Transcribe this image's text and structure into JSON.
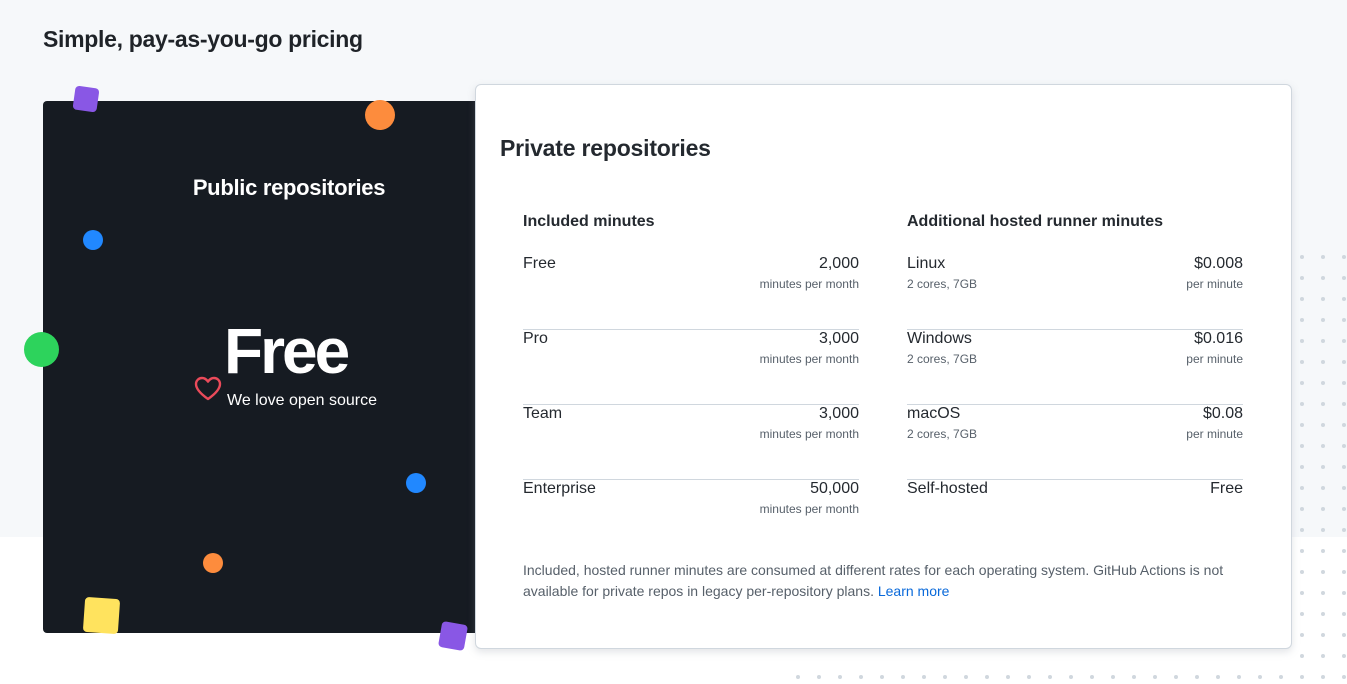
{
  "page": {
    "title": "Simple, pay-as-you-go pricing"
  },
  "public": {
    "title": "Public repositories",
    "price": "Free",
    "tagline": "We love open source"
  },
  "private": {
    "title": "Private repositories",
    "included": {
      "heading": "Included minutes",
      "rows": [
        {
          "name": "Free",
          "value": "2,000",
          "unit": "minutes per month"
        },
        {
          "name": "Pro",
          "value": "3,000",
          "unit": "minutes per month"
        },
        {
          "name": "Team",
          "value": "3,000",
          "unit": "minutes per month"
        },
        {
          "name": "Enterprise",
          "value": "50,000",
          "unit": "minutes per month"
        }
      ]
    },
    "additional": {
      "heading": "Additional hosted runner minutes",
      "rows": [
        {
          "name": "Linux",
          "spec": "2 cores, 7GB",
          "value": "$0.008",
          "unit": "per minute"
        },
        {
          "name": "Windows",
          "spec": "2 cores, 7GB",
          "value": "$0.016",
          "unit": "per minute"
        },
        {
          "name": "macOS",
          "spec": "2 cores, 7GB",
          "value": "$0.08",
          "unit": "per minute"
        },
        {
          "name": "Self-hosted",
          "value": "Free"
        }
      ]
    },
    "footnote": "Included, hosted runner minutes are consumed at different rates for each operating system. GitHub Actions is not available for private repos in legacy per-repository plans.",
    "learn_more": "Learn more"
  },
  "colors": {
    "dark_card": "#161b22",
    "purple": "#8957e5",
    "orange": "#fd8c3d",
    "blue": "#2188ff",
    "green": "#2dd35c",
    "yellow": "#ffe35e",
    "heart": "#ea4a5a",
    "link": "#0969da"
  },
  "icons": {
    "heart": "heart-icon"
  }
}
